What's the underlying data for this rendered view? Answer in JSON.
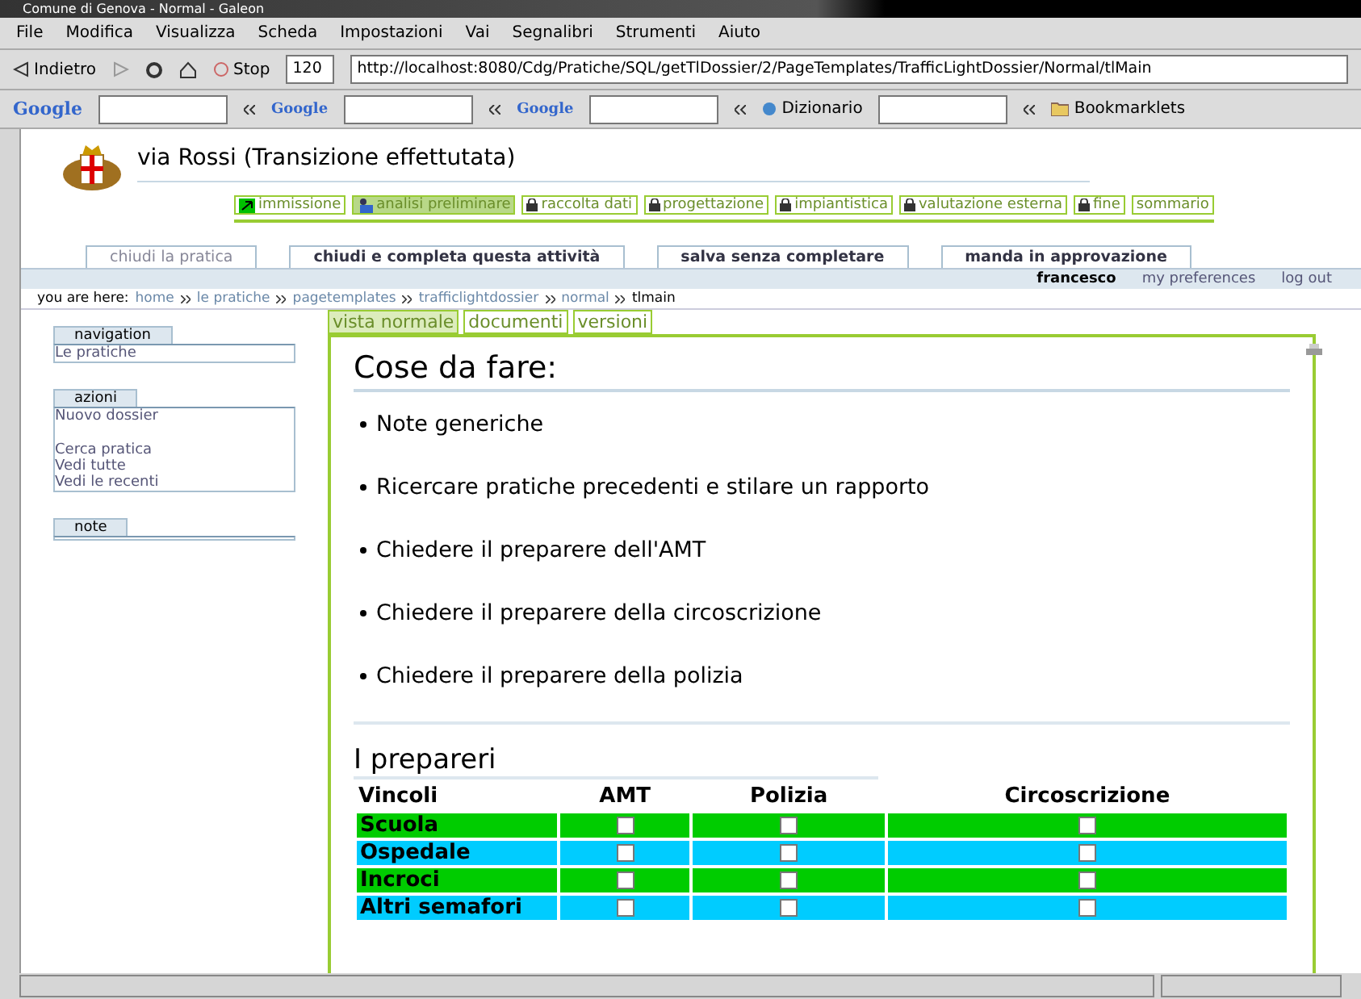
{
  "window": {
    "title": "Comune di Genova - Normal - Galeon"
  },
  "menu": [
    "File",
    "Modifica",
    "Visualizza",
    "Scheda",
    "Impostazioni",
    "Vai",
    "Segnalibri",
    "Strumenti",
    "Aiuto"
  ],
  "toolbar": {
    "back": "Indietro",
    "stop": "Stop",
    "zoom": "120",
    "url": "http://localhost:8080/Cdg/Pratiche/SQL/getTlDossier/2/PageTemplates/TrafficLightDossier/Normal/tlMain"
  },
  "searchbar": [
    {
      "kind": "google",
      "label": "Google"
    },
    {
      "kind": "groups",
      "label": "Google"
    },
    {
      "kind": "images",
      "label": "Google"
    },
    {
      "kind": "dict",
      "label": "Dizionario"
    },
    {
      "kind": "folder",
      "label": "Bookmarklets"
    }
  ],
  "page": {
    "title": "via Rossi",
    "subtitle": "(Transizione effettutata)",
    "workflow": [
      {
        "label": "immissione",
        "kind": "done",
        "selected": false
      },
      {
        "label": "analisi preliminare",
        "kind": "current",
        "selected": true
      },
      {
        "label": "raccolta dati",
        "kind": "locked",
        "selected": false
      },
      {
        "label": "progettazione",
        "kind": "locked",
        "selected": false
      },
      {
        "label": "impiantistica",
        "kind": "locked",
        "selected": false
      },
      {
        "label": "valutazione esterna",
        "kind": "locked",
        "selected": false
      },
      {
        "label": "fine",
        "kind": "locked",
        "selected": false
      },
      {
        "label": "sommario",
        "kind": "plain",
        "selected": false
      }
    ],
    "actions": [
      {
        "label": "chiudi la pratica",
        "disabled": true
      },
      {
        "label": "chiudi e completa questa attività",
        "disabled": false
      },
      {
        "label": "salva senza completare",
        "disabled": false
      },
      {
        "label": "manda in approvazione",
        "disabled": false
      }
    ],
    "user": "francesco",
    "user_links": [
      "my preferences",
      "log out"
    ],
    "breadcrumb_label": "you are here:",
    "breadcrumb": [
      "home",
      "le pratiche",
      "pagetemplates",
      "trafficlightdossier",
      "normal",
      "tlmain"
    ],
    "views": [
      {
        "label": "vista normale",
        "selected": true
      },
      {
        "label": "documenti",
        "selected": false
      },
      {
        "label": "versioni",
        "selected": false
      }
    ],
    "portlets": [
      {
        "title": "navigation",
        "groups": [
          [
            "Le pratiche"
          ]
        ]
      },
      {
        "title": "azioni",
        "groups": [
          [
            "Nuovo dossier"
          ],
          [
            "Cerca pratica",
            "Vedi tutte",
            "Vedi le recenti"
          ]
        ]
      },
      {
        "title": "note"
      }
    ],
    "todo_title": "Cose da fare:",
    "todo": [
      "Note generiche",
      "Ricercare pratiche precedenti e stilare un rapporto",
      "Chiedere il preparere dell'AMT",
      "Chiedere il preparere della circoscrizione",
      "Chiedere il preparere della polizia"
    ],
    "table_title": "I prepareri",
    "columns": [
      "Vincoli",
      "AMT",
      "Polizia",
      "Circoscrizione"
    ],
    "rows": [
      {
        "label": "Scuola",
        "color": "#00cc00",
        "checks": [
          false,
          false,
          false
        ]
      },
      {
        "label": "Ospedale",
        "color": "#00ccff",
        "checks": [
          false,
          false,
          false
        ]
      },
      {
        "label": "Incroci",
        "color": "#00cc00",
        "checks": [
          false,
          false,
          false
        ]
      },
      {
        "label": "Altri semafori",
        "color": "#00ccff",
        "checks": [
          false,
          false,
          false
        ]
      }
    ]
  }
}
